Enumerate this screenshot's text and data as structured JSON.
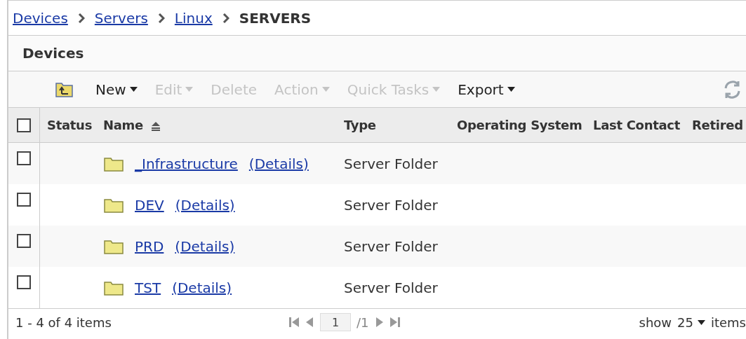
{
  "breadcrumb": [
    {
      "label": "Devices",
      "current": false
    },
    {
      "label": "Servers",
      "current": false
    },
    {
      "label": "Linux",
      "current": false
    },
    {
      "label": "SERVERS",
      "current": true
    }
  ],
  "panel": {
    "title": "Devices"
  },
  "toolbar": [
    {
      "kind": "icon",
      "disabled": false
    },
    {
      "kind": "menu",
      "label": "New",
      "disabled": false
    },
    {
      "kind": "menu",
      "label": "Edit",
      "disabled": true
    },
    {
      "kind": "button",
      "label": "Delete",
      "disabled": true
    },
    {
      "kind": "menu",
      "label": "Action",
      "disabled": true
    },
    {
      "kind": "menu",
      "label": "Quick Tasks",
      "disabled": true
    },
    {
      "kind": "menu",
      "label": "Export",
      "disabled": false
    },
    {
      "kind": "refresh",
      "disabled": false
    }
  ],
  "table": {
    "select_all": {
      "checked": false
    },
    "columns": [
      {
        "label": "Status"
      },
      {
        "label": "Name",
        "sorted": true
      },
      {
        "label": "Type"
      },
      {
        "label": "Operating System"
      },
      {
        "label": "Last Contact"
      },
      {
        "label": "Retired"
      }
    ],
    "rows": [
      {
        "checked": false,
        "name": "_Infrastructure",
        "details": "(Details)",
        "type": "Server Folder"
      },
      {
        "checked": false,
        "name": "DEV",
        "details": "(Details)",
        "type": "Server Folder"
      },
      {
        "checked": false,
        "name": "PRD",
        "details": "(Details)",
        "type": "Server Folder"
      },
      {
        "checked": false,
        "name": "TST",
        "details": "(Details)",
        "type": "Server Folder"
      }
    ]
  },
  "footer": {
    "summary": "1 - 4 of 4 items",
    "page": "1",
    "page_total": "/1",
    "show_label": "show",
    "page_size": "25",
    "items_label": "items"
  }
}
